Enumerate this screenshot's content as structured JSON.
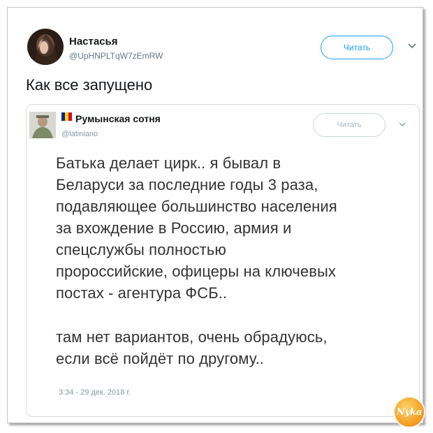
{
  "tweet": {
    "author_name": "Настасья",
    "author_handle": "@UpHNPLTqW7zEmRW",
    "follow_label": "Читать",
    "text": "Как все запущено"
  },
  "quoted_tweet": {
    "author_name": "Румынская сотня",
    "author_handle": "@latiniano",
    "follow_label": "Читать",
    "flag_colors": [
      "#002b7f",
      "#fcd116",
      "#ce1126"
    ],
    "body_lines_1": [
      "Батька делает цирк.. я бывал в",
      "Беларуси за последние годы 3 раза,",
      "подавляющее большинство населения",
      "за вхождение в Россию, армия и",
      "спецслужбы полностью",
      "пророссийские, офицеры на ключевых",
      "постах - агентура ФСБ.."
    ],
    "body_lines_2": [
      "там нет вариантов, очень обрадуюсь,",
      "если всё пойдёт по другому.."
    ],
    "timestamp": "3:34 - 29 дек. 2018 г."
  },
  "watermark": {
    "text": "Nyka"
  },
  "colors": {
    "accent": "#1da1f2",
    "text": "#14171a",
    "muted": "#657786"
  },
  "icons": [
    "chevron-down-icon",
    "flag-romania-icon",
    "avatar"
  ]
}
